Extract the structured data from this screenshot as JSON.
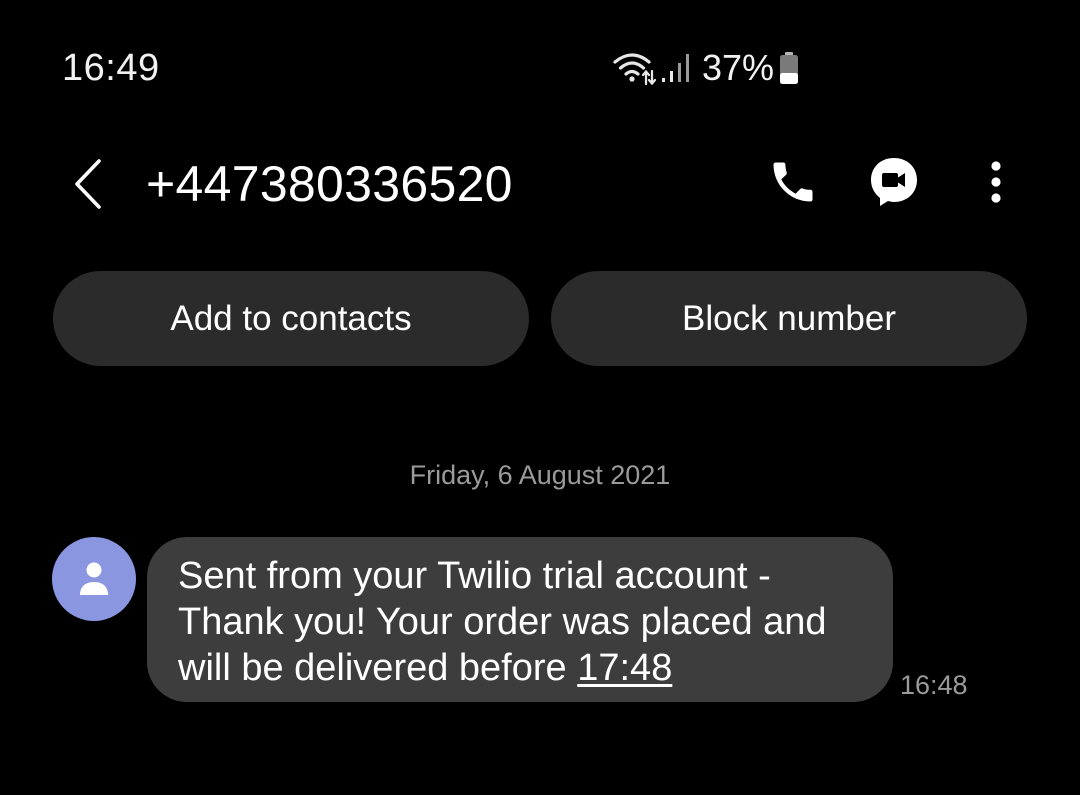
{
  "status_bar": {
    "time": "16:49",
    "battery_percent": "37%",
    "battery_level": 0.37,
    "icons": [
      "wifi-icon",
      "signal-icon",
      "battery-icon"
    ]
  },
  "header": {
    "title": "+447380336520",
    "icons": [
      "back-arrow-icon",
      "phone-icon",
      "video-call-icon",
      "more-vertical-icon"
    ]
  },
  "actions": {
    "add_to_contacts": "Add to contacts",
    "block_number": "Block number"
  },
  "conversation": {
    "date": "Friday, 6 August 2021",
    "message": {
      "lines": [
        "Sent from your Twilio trial account -",
        "Thank you! Your order was placed and",
        "will be delivered before "
      ],
      "link": "17:48",
      "time": "16:48"
    }
  },
  "colors": {
    "background": "#000000",
    "pill": "#2b2b2b",
    "bubble": "#3d3d3d",
    "avatar": "#8b96e0",
    "muted_text": "#9a9a9a"
  }
}
